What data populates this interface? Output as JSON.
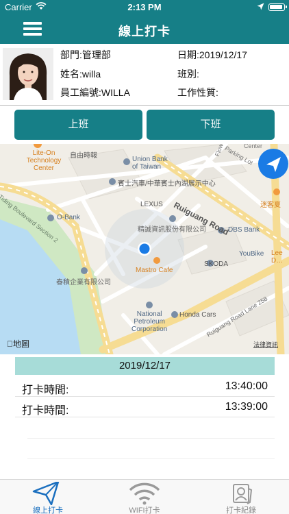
{
  "status_bar": {
    "carrier": "Carrier",
    "time": "2:13 PM"
  },
  "header": {
    "title": "線上打卡",
    "menu_icon": "hamburger-menu-icon",
    "color": "#167f87"
  },
  "profile": {
    "department": "部門:管理部",
    "name": "姓名:willa",
    "employee_id": "員工編號:WILLA",
    "date": "日期:2019/12/17",
    "shift": "班別:",
    "job_type": "工作性質:"
  },
  "actions": {
    "clock_in": "上班",
    "clock_out": "下班"
  },
  "map": {
    "labels": {
      "lite_on": "Lite-On\nTechnology\nCenter",
      "ziyou": "自由時報",
      "union_bank": "Union Bank\nof Taiwan",
      "flower": "Flower M…",
      "parking": "Parking Lot",
      "center": "Center",
      "showroom": "賓士汽車/中華賓士內湖展示中心",
      "lexus": "LEXUS",
      "ruiguang": "Ruiguang Road",
      "mikawa": "迷客夏",
      "tiding": "Tiding Boulevard Section 2",
      "obank": "O-Bank",
      "jingcheng": "精誠資訊股份有限公司",
      "dbs": "DBS Bank",
      "youbike": "YouBike",
      "leede": "Lee D…",
      "skoda": "SKODA",
      "mastro": "Mastro Cafe",
      "chunji": "春積企業有限公司",
      "national": "National\nPetroleum\nCorporation",
      "honda": "Honda Cars",
      "lane258": "Ruiguang Road Lane 258",
      "apple_maps": "地圖",
      "legal": "法律資訊"
    }
  },
  "records": {
    "date": "2019/12/17",
    "rows": [
      {
        "label": "打卡時間:",
        "time": "13:40:00"
      },
      {
        "label": "打卡時間:",
        "time": "13:39:00"
      }
    ]
  },
  "tabs": [
    {
      "label": "線上打卡",
      "icon": "send-arrow-icon",
      "active": true
    },
    {
      "label": "WIFI打卡",
      "icon": "wifi-icon",
      "active": false
    },
    {
      "label": "打卡紀錄",
      "icon": "id-card-icon",
      "active": false
    }
  ],
  "colors": {
    "accent": "#167f87",
    "tab_active": "#1a6fbf",
    "date_bar": "#a7dcd8"
  }
}
